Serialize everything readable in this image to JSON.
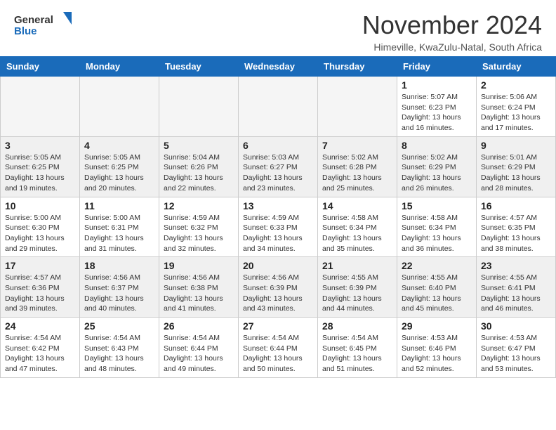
{
  "header": {
    "logo": {
      "general": "General",
      "blue": "Blue"
    },
    "title": "November 2024",
    "location": "Himeville, KwaZulu-Natal, South Africa"
  },
  "calendar": {
    "weekdays": [
      "Sunday",
      "Monday",
      "Tuesday",
      "Wednesday",
      "Thursday",
      "Friday",
      "Saturday"
    ],
    "weeks": [
      [
        {
          "day": null,
          "empty": true
        },
        {
          "day": null,
          "empty": true
        },
        {
          "day": null,
          "empty": true
        },
        {
          "day": null,
          "empty": true
        },
        {
          "day": null,
          "empty": true
        },
        {
          "day": "1",
          "sunrise": "5:07 AM",
          "sunset": "6:23 PM",
          "daylight": "13 hours and 16 minutes."
        },
        {
          "day": "2",
          "sunrise": "5:06 AM",
          "sunset": "6:24 PM",
          "daylight": "13 hours and 17 minutes."
        }
      ],
      [
        {
          "day": "3",
          "sunrise": "5:05 AM",
          "sunset": "6:25 PM",
          "daylight": "13 hours and 19 minutes."
        },
        {
          "day": "4",
          "sunrise": "5:05 AM",
          "sunset": "6:25 PM",
          "daylight": "13 hours and 20 minutes."
        },
        {
          "day": "5",
          "sunrise": "5:04 AM",
          "sunset": "6:26 PM",
          "daylight": "13 hours and 22 minutes."
        },
        {
          "day": "6",
          "sunrise": "5:03 AM",
          "sunset": "6:27 PM",
          "daylight": "13 hours and 23 minutes."
        },
        {
          "day": "7",
          "sunrise": "5:02 AM",
          "sunset": "6:28 PM",
          "daylight": "13 hours and 25 minutes."
        },
        {
          "day": "8",
          "sunrise": "5:02 AM",
          "sunset": "6:29 PM",
          "daylight": "13 hours and 26 minutes."
        },
        {
          "day": "9",
          "sunrise": "5:01 AM",
          "sunset": "6:29 PM",
          "daylight": "13 hours and 28 minutes."
        }
      ],
      [
        {
          "day": "10",
          "sunrise": "5:00 AM",
          "sunset": "6:30 PM",
          "daylight": "13 hours and 29 minutes."
        },
        {
          "day": "11",
          "sunrise": "5:00 AM",
          "sunset": "6:31 PM",
          "daylight": "13 hours and 31 minutes."
        },
        {
          "day": "12",
          "sunrise": "4:59 AM",
          "sunset": "6:32 PM",
          "daylight": "13 hours and 32 minutes."
        },
        {
          "day": "13",
          "sunrise": "4:59 AM",
          "sunset": "6:33 PM",
          "daylight": "13 hours and 34 minutes."
        },
        {
          "day": "14",
          "sunrise": "4:58 AM",
          "sunset": "6:34 PM",
          "daylight": "13 hours and 35 minutes."
        },
        {
          "day": "15",
          "sunrise": "4:58 AM",
          "sunset": "6:34 PM",
          "daylight": "13 hours and 36 minutes."
        },
        {
          "day": "16",
          "sunrise": "4:57 AM",
          "sunset": "6:35 PM",
          "daylight": "13 hours and 38 minutes."
        }
      ],
      [
        {
          "day": "17",
          "sunrise": "4:57 AM",
          "sunset": "6:36 PM",
          "daylight": "13 hours and 39 minutes."
        },
        {
          "day": "18",
          "sunrise": "4:56 AM",
          "sunset": "6:37 PM",
          "daylight": "13 hours and 40 minutes."
        },
        {
          "day": "19",
          "sunrise": "4:56 AM",
          "sunset": "6:38 PM",
          "daylight": "13 hours and 41 minutes."
        },
        {
          "day": "20",
          "sunrise": "4:56 AM",
          "sunset": "6:39 PM",
          "daylight": "13 hours and 43 minutes."
        },
        {
          "day": "21",
          "sunrise": "4:55 AM",
          "sunset": "6:39 PM",
          "daylight": "13 hours and 44 minutes."
        },
        {
          "day": "22",
          "sunrise": "4:55 AM",
          "sunset": "6:40 PM",
          "daylight": "13 hours and 45 minutes."
        },
        {
          "day": "23",
          "sunrise": "4:55 AM",
          "sunset": "6:41 PM",
          "daylight": "13 hours and 46 minutes."
        }
      ],
      [
        {
          "day": "24",
          "sunrise": "4:54 AM",
          "sunset": "6:42 PM",
          "daylight": "13 hours and 47 minutes."
        },
        {
          "day": "25",
          "sunrise": "4:54 AM",
          "sunset": "6:43 PM",
          "daylight": "13 hours and 48 minutes."
        },
        {
          "day": "26",
          "sunrise": "4:54 AM",
          "sunset": "6:44 PM",
          "daylight": "13 hours and 49 minutes."
        },
        {
          "day": "27",
          "sunrise": "4:54 AM",
          "sunset": "6:44 PM",
          "daylight": "13 hours and 50 minutes."
        },
        {
          "day": "28",
          "sunrise": "4:54 AM",
          "sunset": "6:45 PM",
          "daylight": "13 hours and 51 minutes."
        },
        {
          "day": "29",
          "sunrise": "4:53 AM",
          "sunset": "6:46 PM",
          "daylight": "13 hours and 52 minutes."
        },
        {
          "day": "30",
          "sunrise": "4:53 AM",
          "sunset": "6:47 PM",
          "daylight": "13 hours and 53 minutes."
        }
      ]
    ]
  }
}
